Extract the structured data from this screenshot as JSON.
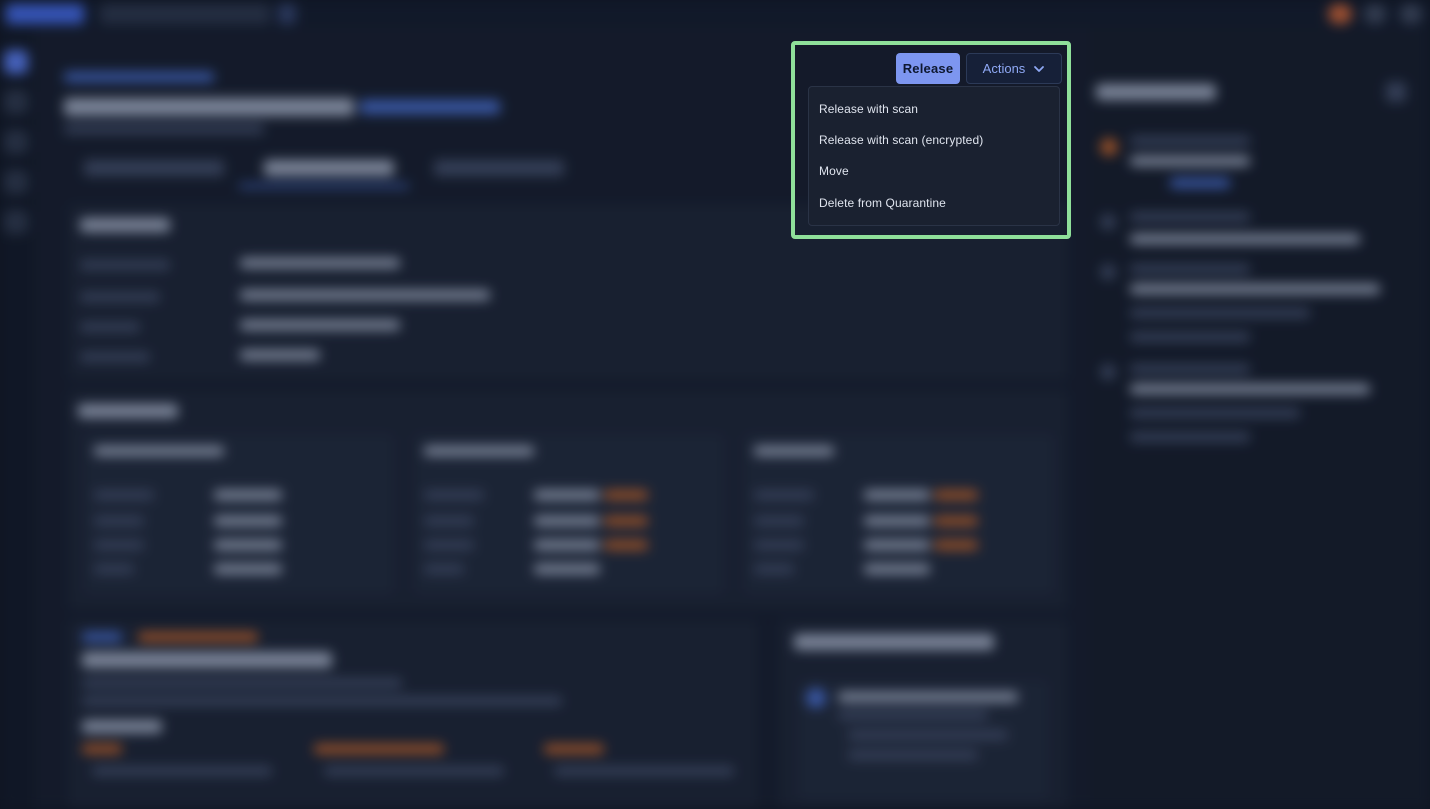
{
  "toolbar": {
    "release_label": "Release",
    "actions_label": "Actions"
  },
  "actions_menu": {
    "items": [
      {
        "label": "Release with scan"
      },
      {
        "label": "Release with scan (encrypted)"
      },
      {
        "label": "Move"
      },
      {
        "label": "Delete from Quarantine"
      }
    ]
  },
  "colors": {
    "background": "#0f1522",
    "release_button": "#7d96f0",
    "actions_text": "#8fa9f5",
    "highlight_border": "#8fe09a",
    "menu_background": "#1a2130"
  },
  "icons": {
    "actions_caret": "chevron-down-icon"
  }
}
